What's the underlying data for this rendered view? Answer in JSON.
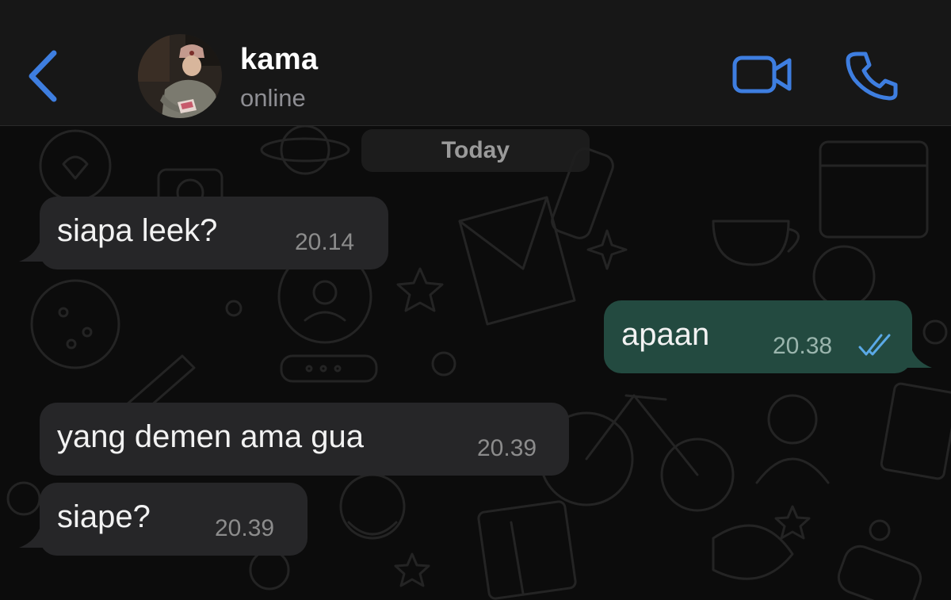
{
  "header": {
    "contact_name": "kama",
    "status": "online",
    "back_icon": "chevron-left-icon",
    "video_icon": "video-camera-icon",
    "call_icon": "phone-icon"
  },
  "chat": {
    "date_separator": "Today",
    "messages": [
      {
        "direction": "incoming",
        "text": "siapa leek?",
        "time": "20.14"
      },
      {
        "direction": "outgoing",
        "text": "apaan",
        "time": "20.38",
        "status_icon": "double-check-icon"
      },
      {
        "direction": "incoming",
        "text": "yang demen ama gua",
        "time": "20.39"
      },
      {
        "direction": "incoming",
        "text": "siape?",
        "time": "20.39"
      }
    ]
  },
  "colors": {
    "accent": "#3e7ee0",
    "incoming_bubble": "#262628",
    "outgoing_bubble": "#234a40",
    "header_bg": "#171717",
    "read_check": "#5aa9e6"
  }
}
